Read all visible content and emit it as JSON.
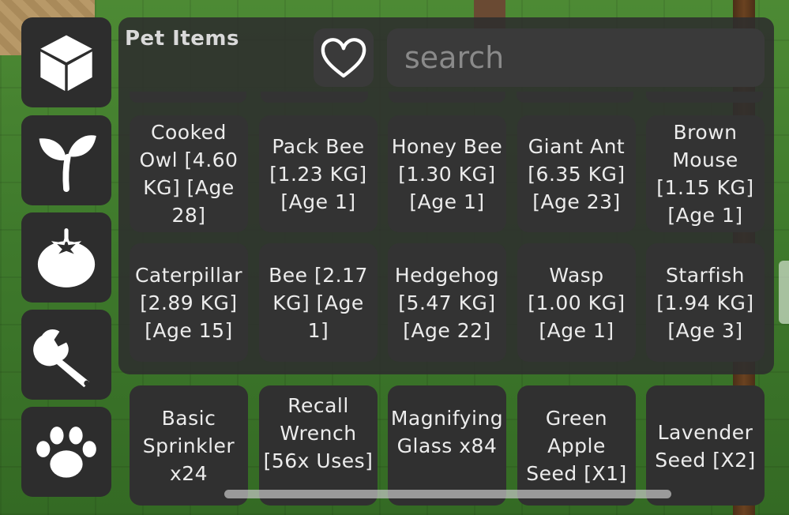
{
  "panel": {
    "title": "Pet Items",
    "search": {
      "placeholder": "search",
      "value": ""
    }
  },
  "rail": [
    {
      "icon": "cube-icon"
    },
    {
      "icon": "sprout-icon"
    },
    {
      "icon": "tomato-icon"
    },
    {
      "icon": "wrench-icon"
    },
    {
      "icon": "paw-icon"
    }
  ],
  "favorite": {
    "icon": "heart-icon"
  },
  "grid": {
    "row1": [
      "Cooked Owl [4.60 KG] [Age 28]",
      "Pack Bee [1.23 KG] [Age 1]",
      "Honey Bee [1.30 KG] [Age 1]",
      "Giant Ant [6.35 KG] [Age 23]",
      "Brown Mouse [1.15 KG] [Age 1]"
    ],
    "row2": [
      "Caterpillar [2.89 KG] [Age 15]",
      "Bee [2.17 KG] [Age 1]",
      "Hedgehog [5.47 KG] [Age 22]",
      "Wasp [1.00 KG] [Age 1]",
      "Starfish [1.94 KG] [Age 3]"
    ]
  },
  "hotbar": [
    "Basic Sprinkler x24",
    "Recall Wrench [56x Uses]",
    "Magnifying Glass x84",
    "Green Apple Seed [X1]",
    "Lavender Seed [X2]"
  ]
}
